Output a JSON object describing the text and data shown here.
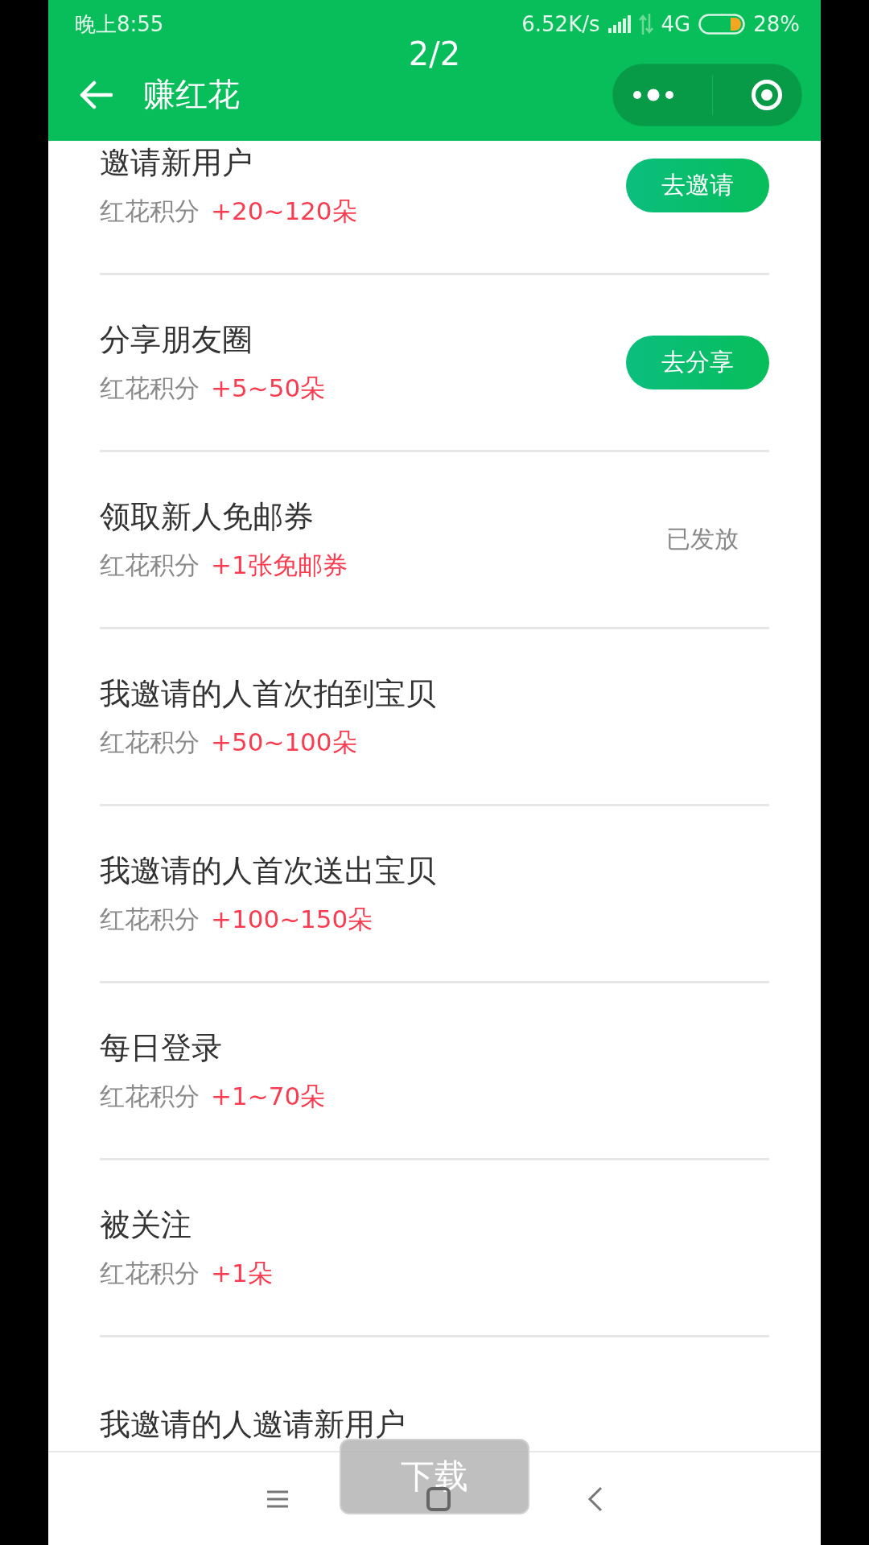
{
  "status_bar": {
    "time": "晚上8:55",
    "speed": "6.52K/s",
    "network": "4G",
    "battery": "28%"
  },
  "viewer_counter": "2/2",
  "header": {
    "title": "赚红花"
  },
  "tasks": [
    {
      "title": "邀请新用户",
      "reward_label": "红花积分",
      "reward": "+20~120朵",
      "kind": "button",
      "action": "去邀请"
    },
    {
      "title": "分享朋友圈",
      "reward_label": "红花积分",
      "reward": "+5~50朵",
      "kind": "button",
      "action": "去分享"
    },
    {
      "title": "领取新人免邮券",
      "reward_label": "红花积分",
      "reward": "+1张免邮券",
      "kind": "status",
      "action": "已发放"
    },
    {
      "title": "我邀请的人首次拍到宝贝",
      "reward_label": "红花积分",
      "reward": "+50~100朵",
      "kind": "none"
    },
    {
      "title": "我邀请的人首次送出宝贝",
      "reward_label": "红花积分",
      "reward": "+100~150朵",
      "kind": "none"
    },
    {
      "title": "每日登录",
      "reward_label": "红花积分",
      "reward": "+1~70朵",
      "kind": "none"
    },
    {
      "title": "被关注",
      "reward_label": "红花积分",
      "reward": "+1朵",
      "kind": "none"
    },
    {
      "title": "我邀请的人邀请新用户",
      "kind": "none"
    }
  ],
  "download_button": "下载"
}
